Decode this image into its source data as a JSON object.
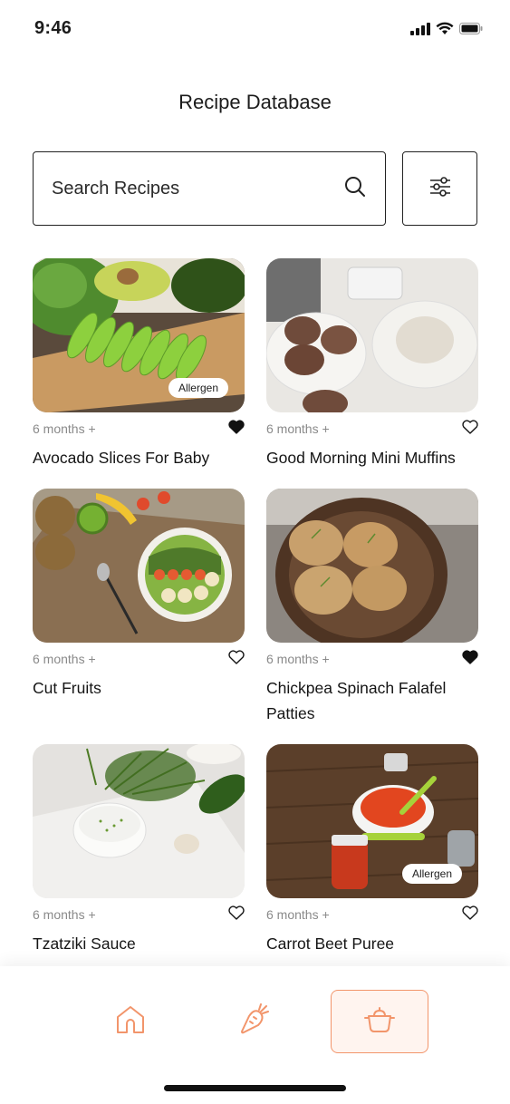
{
  "status": {
    "time": "9:46"
  },
  "header": {
    "title": "Recipe Database"
  },
  "search": {
    "placeholder": "Search Recipes"
  },
  "recipes": [
    {
      "age": "6 months +",
      "title": "Avocado Slices For Baby",
      "favorited": true,
      "badge": "Allergen"
    },
    {
      "age": "6 months +",
      "title": "Good Morning Mini Muffins",
      "favorited": false,
      "badge": ""
    },
    {
      "age": "6 months +",
      "title": "Cut Fruits",
      "favorited": false,
      "badge": ""
    },
    {
      "age": "6 months +",
      "title": "Chickpea Spinach Falafel Patties",
      "favorited": true,
      "badge": ""
    },
    {
      "age": "6 months +",
      "title": "Tzatziki Sauce",
      "favorited": false,
      "badge": ""
    },
    {
      "age": "6 months +",
      "title": "Carrot Beet Puree",
      "favorited": false,
      "badge": "Allergen"
    }
  ],
  "nav": {
    "items": [
      {
        "icon": "home-icon",
        "active": false
      },
      {
        "icon": "carrot-icon",
        "active": false
      },
      {
        "icon": "cooking-pot-icon",
        "active": true
      }
    ],
    "accent": "#f2956b"
  }
}
